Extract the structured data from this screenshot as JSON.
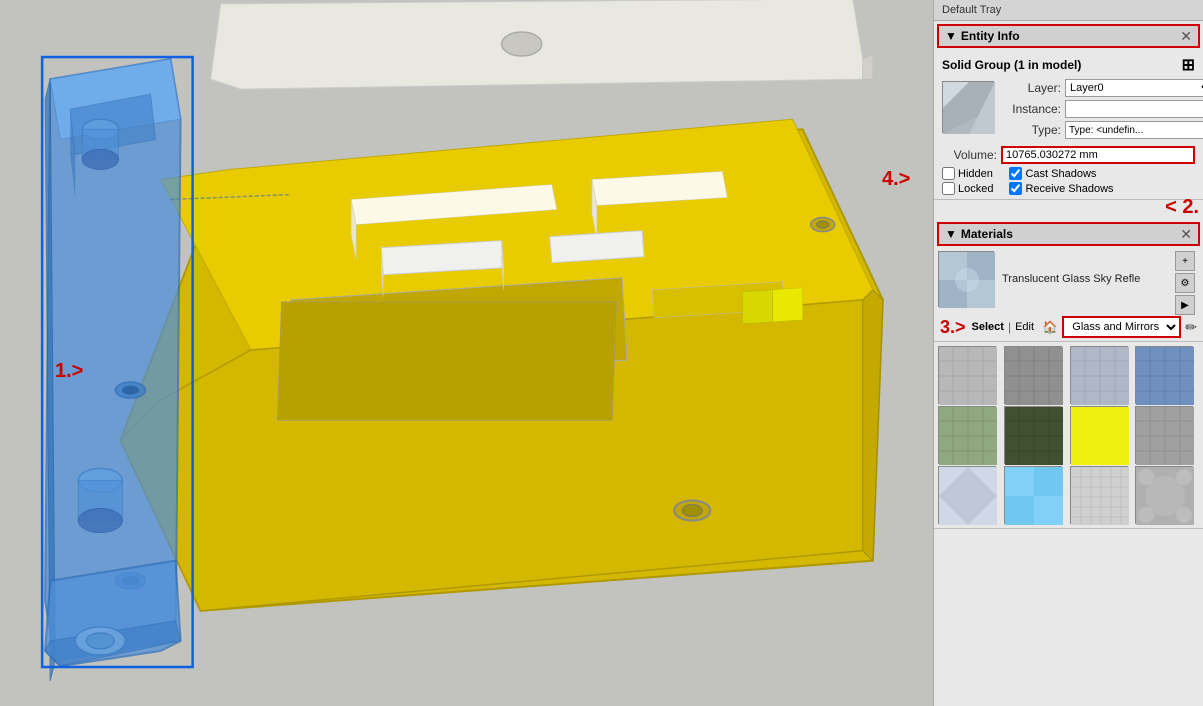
{
  "tray": {
    "title": "Default Tray"
  },
  "entity_info": {
    "title": "Entity Info",
    "subtitle": "Solid Group (1 in model)",
    "layer_label": "Layer:",
    "layer_value": "Layer0",
    "instance_label": "Instance:",
    "instance_value": "",
    "type_label": "Type:",
    "type_value": "Type: <undefin...",
    "volume_label": "Volume:",
    "volume_value": "10765.030272 mm",
    "hidden_label": "Hidden",
    "locked_label": "Locked",
    "cast_shadows_label": "Cast Shadows",
    "receive_shadows_label": "Receive Shadows",
    "cast_shadows_checked": true,
    "receive_shadows_checked": true
  },
  "materials": {
    "title": "Materials",
    "material_name": "Translucent Glass Sky Refle",
    "label_2": "< 2.",
    "label_3": "3.>",
    "select_tab": "Select",
    "edit_tab": "Edit",
    "category": "Glass and Mirrors",
    "swatches": [
      {
        "color": "#b0b0b0",
        "pattern": "grid"
      },
      {
        "color": "#909090",
        "pattern": "grid-dark"
      },
      {
        "color": "#c0c0c8",
        "pattern": "grid-blue"
      },
      {
        "color": "#8090b0",
        "pattern": "blue-grid"
      },
      {
        "color": "#90a080",
        "pattern": "green-grid"
      },
      {
        "color": "#405030",
        "pattern": "dark-green"
      },
      {
        "color": "#e8e820",
        "pattern": "yellow"
      },
      {
        "color": "#909090",
        "pattern": "gray"
      },
      {
        "color": "#c0c8d0",
        "pattern": "light-diamond"
      },
      {
        "color": "#80c8e8",
        "pattern": "cyan"
      },
      {
        "color": "#d0d0d0",
        "pattern": "light-gray"
      },
      {
        "color": "#aaaaaa",
        "pattern": "mid-gray"
      }
    ]
  },
  "labels": {
    "label_1": "1.>",
    "label_4": "4.>"
  }
}
